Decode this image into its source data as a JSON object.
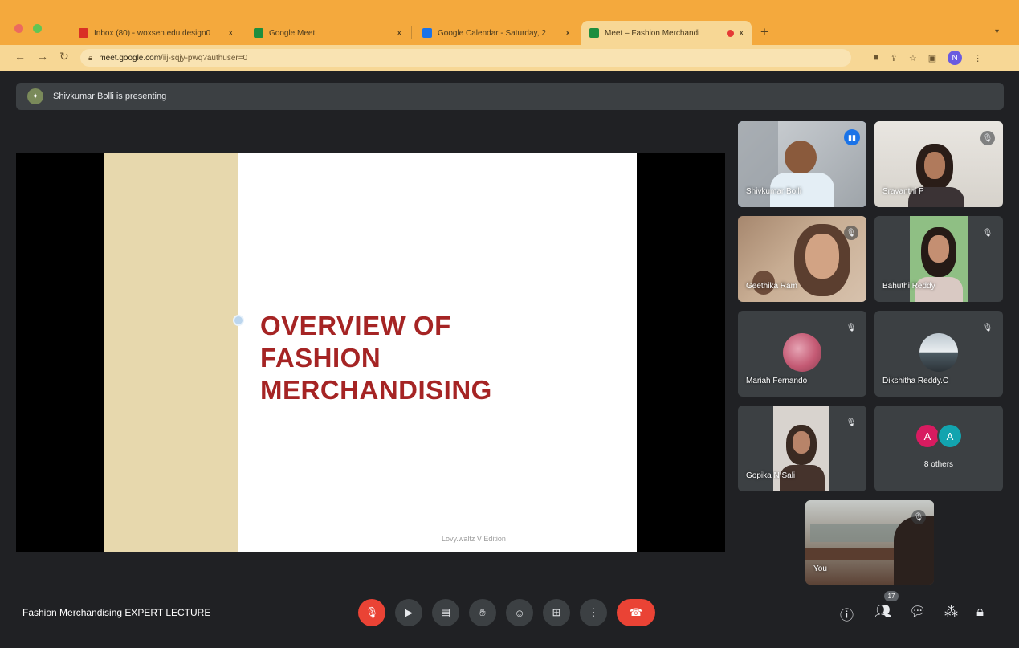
{
  "browser": {
    "tabs": [
      {
        "title": "Inbox (80) - woxsen.edu design0",
        "icon": "gmail-icon",
        "color": "#d93025",
        "active": false
      },
      {
        "title": "Google Meet",
        "icon": "meet-icon",
        "color": "#1e8e3e",
        "active": false
      },
      {
        "title": "Google Calendar - Saturday, 2",
        "icon": "calendar-icon",
        "color": "#1a73e8",
        "active": false
      },
      {
        "title": "Meet – Fashion Merchandi",
        "icon": "meet-icon",
        "color": "#1e8e3e",
        "active": true
      }
    ],
    "new_tab": "+",
    "close_glyph": "x",
    "url_host": "meet.google.com",
    "url_path": "/iij-sqjy-pwq?authuser=0",
    "profile_initial": "N"
  },
  "meet": {
    "presenting_text": "Shivkumar Bolli is presenting",
    "meeting_title": "Fashion Merchandising EXPERT LECTURE",
    "slide": {
      "title_lines": [
        "OVERVIEW OF",
        "FASHION",
        "MERCHANDISING"
      ],
      "footer": "Lovy.waltz V Edition"
    },
    "participants": [
      {
        "name": "Shivkumar Bolli",
        "speaking": true,
        "video": true
      },
      {
        "name": "Sravanthi P",
        "speaking": false,
        "video": true
      },
      {
        "name": "Geethika Ram",
        "speaking": false,
        "video": true
      },
      {
        "name": "Bahuthi Reddy",
        "speaking": false,
        "video": true
      },
      {
        "name": "Mariah Fernando",
        "speaking": false,
        "video": false
      },
      {
        "name": "Dikshitha Reddy.C",
        "speaking": false,
        "video": false
      },
      {
        "name": "Gopika N Sali",
        "speaking": false,
        "video": true
      }
    ],
    "others": {
      "label": "8 others",
      "avatars": [
        "A",
        "A"
      ],
      "colors": [
        "#d81b60",
        "#12a4af"
      ]
    },
    "self_label": "You",
    "controls": [
      "mic-off-icon",
      "camera-icon",
      "captions-icon",
      "raise-hand-icon",
      "emoji-icon",
      "present-icon",
      "more-options-icon",
      "hangup-icon"
    ],
    "people_count": "17",
    "colors": {
      "background": "#202124",
      "tile": "#3c4043",
      "accent_red": "#ea4335",
      "speaking_outline": "#8ab4f8",
      "slide_title": "#a52424",
      "chrome": "#f4a93d"
    }
  }
}
